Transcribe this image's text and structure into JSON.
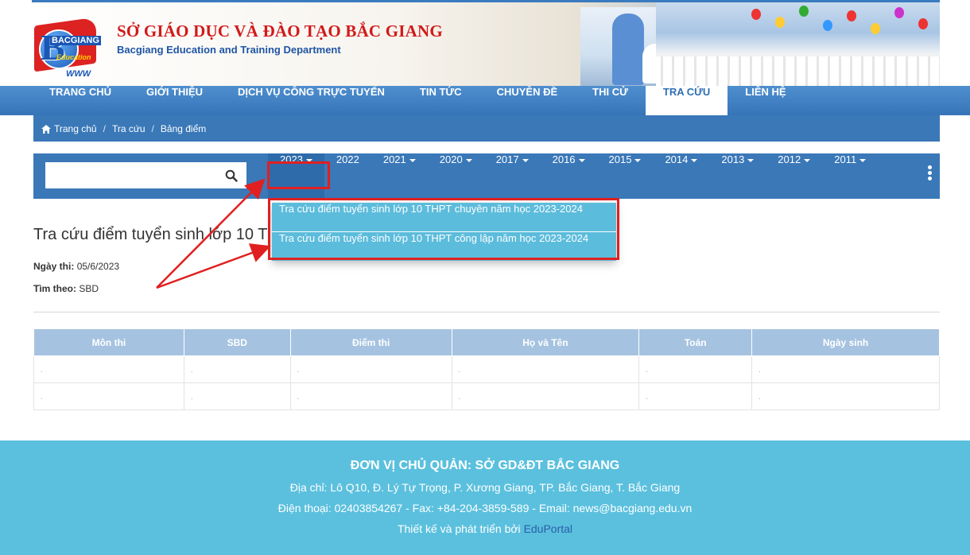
{
  "header": {
    "title_vn": "SỞ GIÁO DỤC VÀ ĐÀO TẠO BẮC GIANG",
    "title_en": "Bacgiang Education and Training Department",
    "logo": {
      "brand": "BACGIANG",
      "tagline": "Education",
      "web": "WWW"
    }
  },
  "nav": {
    "items": [
      {
        "label": "TRANG CHỦ"
      },
      {
        "label": "GIỚI THIỆU"
      },
      {
        "label": "DỊCH VỤ CÔNG TRỰC TUYẾN"
      },
      {
        "label": "TIN TỨC"
      },
      {
        "label": "CHUYÊN ĐỀ"
      },
      {
        "label": "THI CỬ"
      },
      {
        "label": "TRA CỨU"
      },
      {
        "label": "LIÊN HỆ"
      }
    ],
    "active_index": 6
  },
  "breadcrumb": {
    "items": [
      "Trang chủ",
      "Tra cứu",
      "Bảng điểm"
    ],
    "separator": "/"
  },
  "search": {
    "value": "",
    "placeholder": ""
  },
  "years": [
    {
      "label": "2023",
      "dropdown": true
    },
    {
      "label": "2022",
      "dropdown": false
    },
    {
      "label": "2021",
      "dropdown": true
    },
    {
      "label": "2020",
      "dropdown": true
    },
    {
      "label": "2017",
      "dropdown": true
    },
    {
      "label": "2016",
      "dropdown": true
    },
    {
      "label": "2015",
      "dropdown": true
    },
    {
      "label": "2014",
      "dropdown": true
    },
    {
      "label": "2013",
      "dropdown": true
    },
    {
      "label": "2012",
      "dropdown": true
    },
    {
      "label": "2011",
      "dropdown": true
    }
  ],
  "dropdown": {
    "items": [
      "Tra cứu điểm tuyển sinh lớp 10 THPT chuyên năm học 2023-2024",
      "Tra cứu điểm tuyển sinh lớp 10 THPT công lập năm học 2023-2024"
    ]
  },
  "main": {
    "title": "Tra cứu điểm tuyển sinh lớp 10 T",
    "date_label": "Ngày thi:",
    "date_value": "05/6/2023",
    "find_label": "Tìm theo:",
    "find_value": "SBD"
  },
  "table": {
    "headers": [
      "Môn thi",
      "SBD",
      "Điểm thi",
      "Họ và Tên",
      "Toán",
      "Ngày sinh"
    ],
    "rows": [
      [
        ".",
        ".",
        ".",
        ".",
        ".",
        "."
      ],
      [
        ".",
        ".",
        ".",
        ".",
        ".",
        "."
      ]
    ]
  },
  "footer": {
    "title": "ĐƠN VỊ CHỦ QUẢN: SỞ GD&ĐT BẮC GIANG",
    "address": "Địa chỉ: Lô Q10, Đ. Lý Tự Trọng, P. Xương Giang, TP. Bắc Giang, T. Bắc Giang",
    "contact": "Điện thoại: 02403854267 - Fax: +84-204-3859-589 - Email: news@bacgiang.edu.vn",
    "credit_prefix": "Thiết kế và phát triển bởi",
    "credit_link": "EduPortal"
  },
  "colors": {
    "nav": "#3a78b8",
    "accent_red": "#e02020",
    "dropdown_item": "#5cbcdc",
    "footer": "#5bc0de",
    "table_header": "#a5c3e0"
  },
  "icons": [
    "home-icon",
    "search-icon",
    "caret-down-icon",
    "kebab-menu-icon"
  ]
}
